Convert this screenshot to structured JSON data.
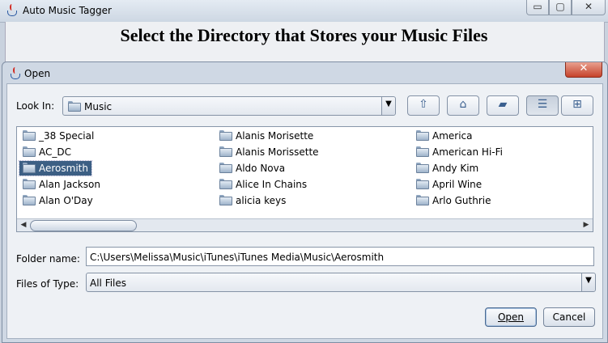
{
  "main_window": {
    "title": "Auto Music Tagger",
    "heading": "Select the Directory that Stores your Music Files",
    "icon": "java-icon",
    "controls": {
      "minimize": "▭",
      "maximize": "▢",
      "close": "✕"
    }
  },
  "dialog": {
    "title": "Open",
    "close_glyph": "✕",
    "look_in_label": "Look In:",
    "look_in_value": "Music",
    "toolbar": [
      {
        "name": "up-one-level-button",
        "glyph": "⇧"
      },
      {
        "name": "home-button",
        "glyph": "⌂"
      },
      {
        "name": "new-folder-button",
        "glyph": "▰"
      },
      {
        "name": "list-view-button",
        "glyph": "☰"
      },
      {
        "name": "details-view-button",
        "glyph": "⊞"
      }
    ],
    "files": {
      "columns": [
        [
          "_38 Special",
          "AC_DC",
          "Aerosmith",
          "Alan Jackson",
          "Alan O'Day"
        ],
        [
          "Alanis Morisette",
          "Alanis Morissette",
          "Aldo Nova",
          "Alice In Chains",
          "alicia keys"
        ],
        [
          "America",
          "American Hi-Fi",
          "Andy Kim",
          "April Wine",
          "Arlo Guthrie"
        ]
      ],
      "selected": "Aerosmith"
    },
    "folder_name_label": "Folder name:",
    "folder_name_value": "C:\\Users\\Melissa\\Music\\iTunes\\iTunes Media\\Music\\Aerosmith",
    "files_of_type_label": "Files of Type:",
    "files_of_type_value": "All Files",
    "open_button": "Open",
    "cancel_button": "Cancel"
  },
  "colors": {
    "selection": "#3c5f84",
    "dialog_background": "#eef1f5",
    "close_button": "#c6432b"
  }
}
